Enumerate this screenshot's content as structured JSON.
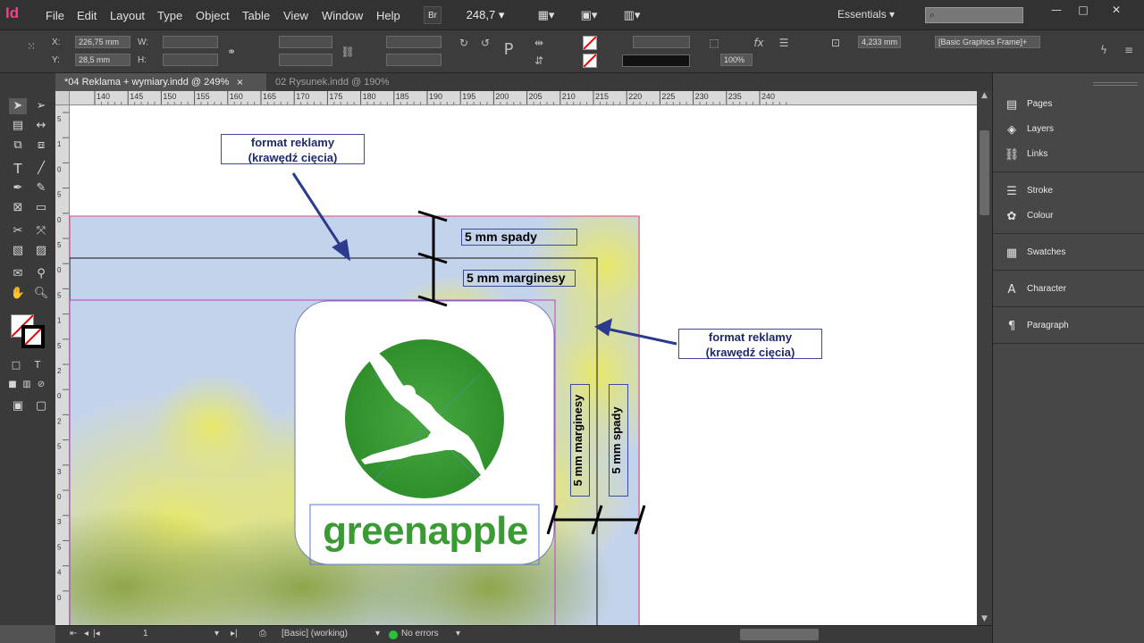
{
  "app": {
    "logo": "Id"
  },
  "menu": [
    "File",
    "Edit",
    "Layout",
    "Type",
    "Object",
    "Table",
    "View",
    "Window",
    "Help"
  ],
  "topbar": {
    "bridge_label": "Br",
    "zoom": "248,7",
    "workspace": "Essentials",
    "search_placeholder": ""
  },
  "window_controls": {
    "minimize": "—",
    "restore": "□",
    "close": "✕"
  },
  "control_panel": {
    "x_label": "X:",
    "x_value": "226,75 mm",
    "y_label": "Y:",
    "y_value": "28,5 mm",
    "w_label": "W:",
    "h_label": "H:",
    "stroke_weight": "4,233 mm",
    "opacity": "100%",
    "object_style": "[Basic Graphics Frame]+"
  },
  "tabs": [
    {
      "label": "*04 Reklama + wymiary.indd @ 249%",
      "close": "×"
    },
    {
      "label": "02 Rysunek.indd @ 190%",
      "close": "×"
    }
  ],
  "ruler": {
    "h_labels": [
      "140",
      "145",
      "150",
      "155",
      "160",
      "165",
      "170",
      "175",
      "180",
      "185",
      "190",
      "195",
      "200",
      "205",
      "210",
      "215",
      "220",
      "225",
      "230",
      "235",
      "240"
    ],
    "v_labels": [
      "5",
      "1",
      "0",
      "5",
      "0",
      "5",
      "0",
      "5",
      "1",
      "5",
      "2",
      "0",
      "2",
      "5",
      "3",
      "0",
      "3",
      "5",
      "4",
      "0"
    ]
  },
  "canvas": {
    "annotation_top": "format reklamy\n(krawędź cięcia)",
    "annotation_right": "format reklamy\n(krawędź cięcia)",
    "label_bleed_h": "5 mm spady",
    "label_margin_h": "5 mm marginesy",
    "label_margin_v": "5 mm marginesy",
    "label_bleed_v": "5 mm spady",
    "logo_text": "greenapple"
  },
  "statusbar": {
    "page": "1",
    "preflight_profile": "[Basic] (working)",
    "errors": "No errors"
  },
  "panels": [
    {
      "label": "Pages",
      "icon": "pages-icon"
    },
    {
      "label": "Layers",
      "icon": "layers-icon"
    },
    {
      "label": "Links",
      "icon": "links-icon"
    },
    {
      "label": "Stroke",
      "icon": "stroke-icon"
    },
    {
      "label": "Colour",
      "icon": "colour-icon"
    },
    {
      "label": "Swatches",
      "icon": "swatches-icon"
    },
    {
      "label": "Character",
      "icon": "character-icon"
    },
    {
      "label": "Paragraph",
      "icon": "paragraph-icon"
    }
  ],
  "colors": {
    "accent": "#ff3c8c",
    "logo_green": "#3a9b35",
    "annotation_blue": "#2b3a8c",
    "bleed_line": "#e0457a"
  }
}
